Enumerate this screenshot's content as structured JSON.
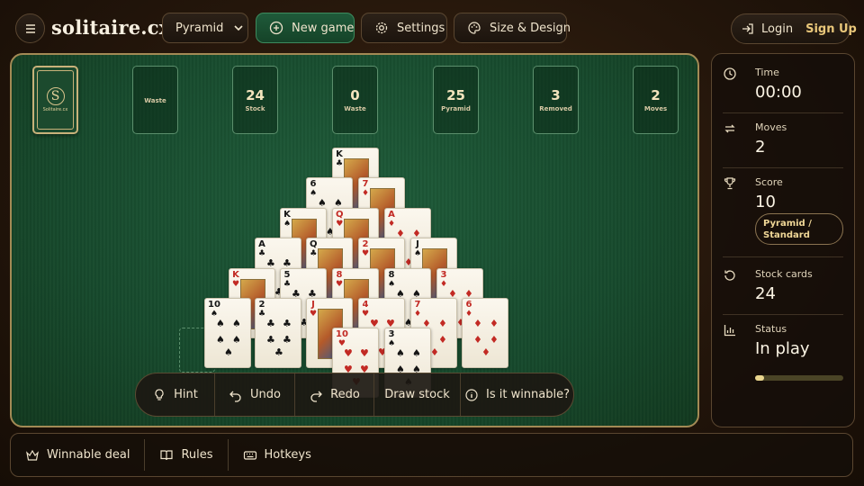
{
  "header": {
    "logo": "solitaire.cx",
    "variant": "Pyramid",
    "new_game": "New game",
    "settings": "Settings",
    "size_design": "Size & Design",
    "login": "Login",
    "signup": "Sign Up"
  },
  "board": {
    "stock_back_text": "Solitaire.cx",
    "stock_back_mark": "S",
    "slots": [
      {
        "num": "",
        "label": "Waste"
      },
      {
        "num": "24",
        "label": "Stock"
      },
      {
        "num": "0",
        "label": "Waste"
      },
      {
        "num": "25",
        "label": "Pyramid"
      },
      {
        "num": "3",
        "label": "Removed"
      },
      {
        "num": "2",
        "label": "Moves"
      }
    ],
    "cards": [
      {
        "rank": "K",
        "suit": "♣",
        "color": "blk",
        "face": true
      },
      {
        "rank": "6",
        "suit": "♠",
        "color": "blk",
        "face": false
      },
      {
        "rank": "7",
        "suit": "♦",
        "color": "red",
        "face": true
      },
      {
        "rank": "K",
        "suit": "♠",
        "color": "blk",
        "face": true
      },
      {
        "rank": "Q",
        "suit": "♥",
        "color": "red",
        "face": true
      },
      {
        "rank": "A",
        "suit": "♦",
        "color": "red",
        "face": false
      },
      {
        "rank": "A",
        "suit": "♣",
        "color": "blk",
        "face": false
      },
      {
        "rank": "Q",
        "suit": "♣",
        "color": "blk",
        "face": true
      },
      {
        "rank": "2",
        "suit": "♥",
        "color": "red",
        "face": true
      },
      {
        "rank": "J",
        "suit": "♠",
        "color": "blk",
        "face": true
      },
      {
        "rank": "K",
        "suit": "♥",
        "color": "red",
        "face": true
      },
      {
        "rank": "5",
        "suit": "♣",
        "color": "blk",
        "face": false
      },
      {
        "rank": "8",
        "suit": "♥",
        "color": "red",
        "face": true
      },
      {
        "rank": "8",
        "suit": "♠",
        "color": "blk",
        "face": false
      },
      {
        "rank": "3",
        "suit": "♦",
        "color": "red",
        "face": false
      },
      {
        "rank": "10",
        "suit": "♠",
        "color": "blk",
        "face": false
      },
      {
        "rank": "2",
        "suit": "♣",
        "color": "blk",
        "face": false
      },
      {
        "rank": "J",
        "suit": "♥",
        "color": "red",
        "face": true
      },
      {
        "rank": "4",
        "suit": "♥",
        "color": "red",
        "face": false
      },
      {
        "rank": "7",
        "suit": "♦",
        "color": "red",
        "face": false
      },
      {
        "rank": "6",
        "suit": "♦",
        "color": "red",
        "face": false
      },
      {
        "rank": "10",
        "suit": "♥",
        "color": "red",
        "face": false
      },
      {
        "rank": "3",
        "suit": "♠",
        "color": "blk",
        "face": false
      }
    ]
  },
  "toolbar": {
    "hint": "Hint",
    "undo": "Undo",
    "redo": "Redo",
    "draw_stock": "Draw stock",
    "winnable": "Is it winnable?"
  },
  "sidebar": {
    "time_label": "Time",
    "time_value": "00:00",
    "moves_label": "Moves",
    "moves_value": "2",
    "score_label": "Score",
    "score_value": "10",
    "mode": "Pyramid / Standard",
    "stock_label": "Stock cards",
    "stock_value": "24",
    "status_label": "Status",
    "status_value": "In play",
    "progress": 0.1
  },
  "bottom": {
    "winnable_deal": "Winnable deal",
    "rules": "Rules",
    "hotkeys": "Hotkeys"
  }
}
